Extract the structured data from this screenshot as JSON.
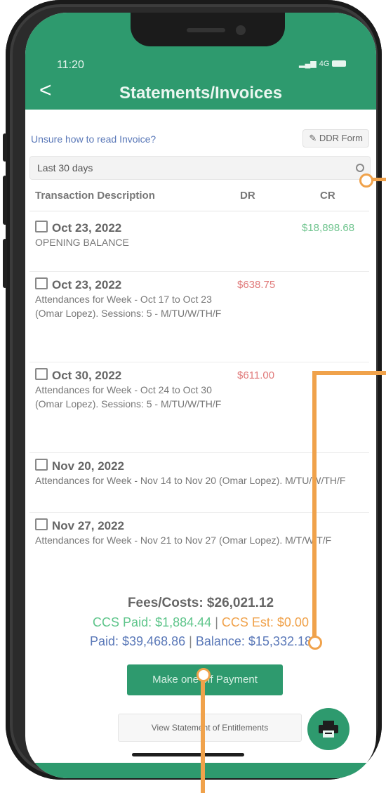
{
  "status_bar": {
    "time": "11:20",
    "signal": "4G"
  },
  "header": {
    "back_icon": "chevron-left-icon",
    "title": "Statements/Invoices"
  },
  "help": {
    "link_text": "Unsure how to read Invoice?",
    "ddr_button": "DDR Form",
    "ddr_icon": "edit-icon"
  },
  "filter": {
    "selected": "Last 30 days"
  },
  "table": {
    "headers": [
      "Transaction Description",
      "DR",
      "CR"
    ],
    "rows": [
      {
        "date": "Oct 23, 2022",
        "description": "OPENING BALANCE",
        "dr": "",
        "cr": "$18,898.68"
      },
      {
        "date": "Oct 23, 2022",
        "description": "Attendances for Week - Oct 17 to Oct 23 (Omar Lopez). Sessions: 5 - M/TU/W/TH/F",
        "dr": "$638.75",
        "cr": ""
      },
      {
        "date": "Oct 30, 2022",
        "description": "Attendances for Week - Oct 24 to Oct 30 (Omar Lopez). Sessions: 5 - M/TU/W/TH/F",
        "dr": "$611.00",
        "cr": ""
      },
      {
        "date": "Nov 20, 2022",
        "description": "Attendances for Week - Nov 14 to Nov 20 (Omar Lopez). M/TU/W/TH/F",
        "dr": "",
        "cr": ""
      },
      {
        "date": "Nov 27, 2022",
        "description": "Attendances for Week - Nov 21 to Nov 27 (Omar Lopez). M/T/W/T/F",
        "dr": "",
        "cr": ""
      }
    ]
  },
  "summary": {
    "fees": "Fees/Costs: $26,021.12",
    "ccs_paid": "CCS Paid: $1,884.44",
    "ccs_est": "CCS Est: $0.00",
    "paid": "Paid: $39,468.86",
    "balance": "Balance: $15,332.18",
    "separator": "|"
  },
  "actions": {
    "pay_button": "Make one off Payment",
    "statement_button": "View Statement of Entitlements",
    "print_icon": "printer-icon"
  },
  "colors": {
    "brand_green": "#2e9a6e",
    "debit_red": "#e07a7a",
    "credit_green": "#6fc48e",
    "estimate_orange": "#f0a24b",
    "link_blue": "#5a78b8",
    "annotation_orange": "#f0a24b"
  }
}
